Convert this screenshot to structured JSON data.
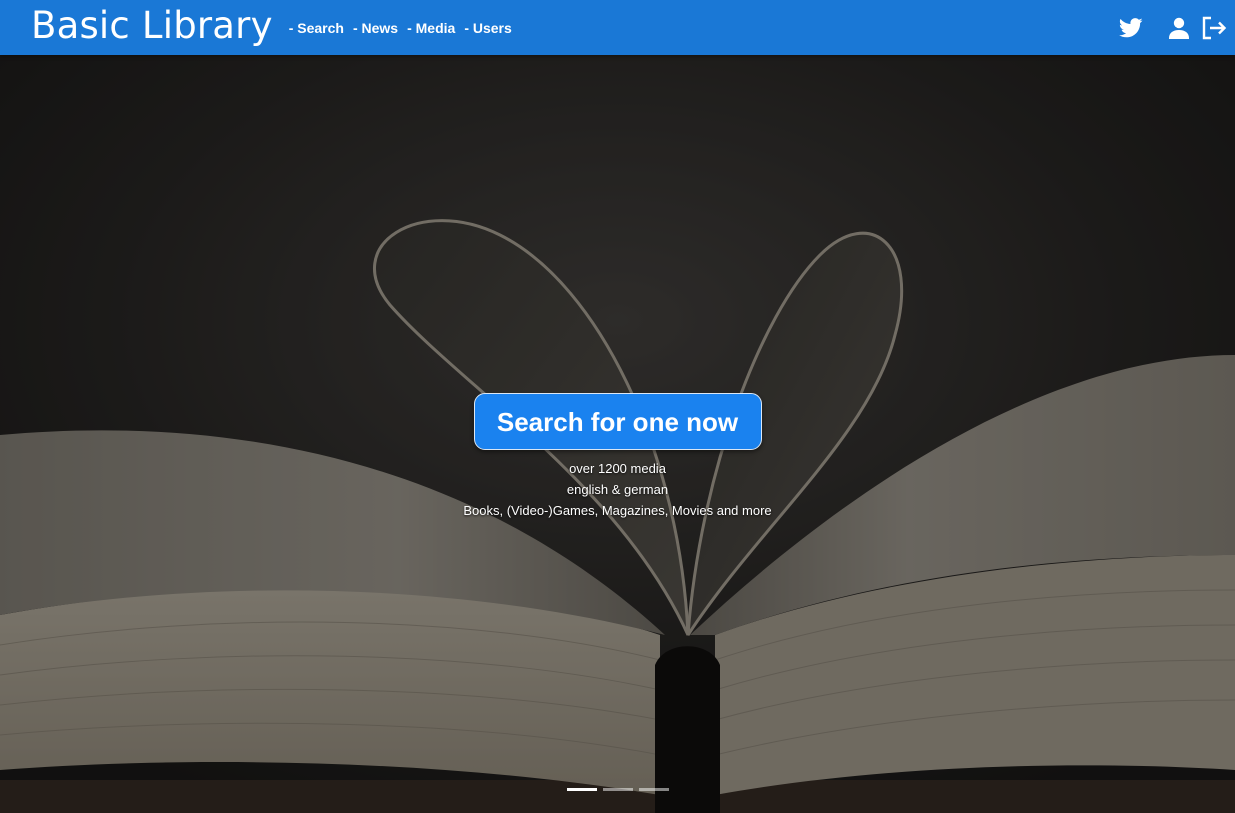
{
  "navbar": {
    "brand": "Basic Library",
    "links": [
      "- Search",
      "- News",
      "- Media",
      "- Users"
    ],
    "icons": [
      "twitter-icon",
      "user-icon",
      "logout-icon"
    ],
    "color": "#1a78d6"
  },
  "hero": {
    "button_label": "Search for one now",
    "lines": [
      "over 1200 media",
      "english & german",
      "Books, (Video-)Games, Magazines, Movies and more"
    ],
    "button_color": "#1a82ef",
    "slides": 3,
    "active_slide": 1
  }
}
